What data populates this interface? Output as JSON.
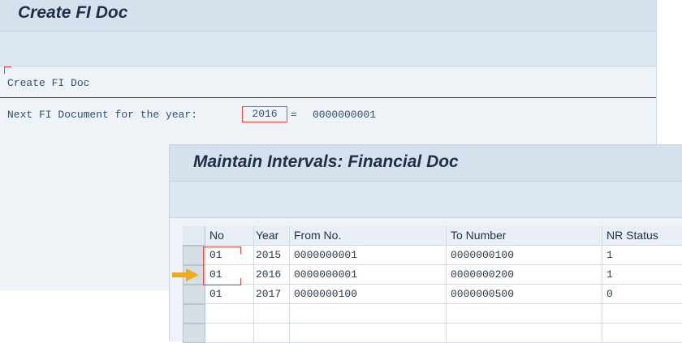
{
  "back_window": {
    "title": "Create FI Doc",
    "heading": "Create FI Doc",
    "label": "Next FI Document for the year:",
    "year_value": "2016",
    "equals": "=",
    "doc_number": "0000000001"
  },
  "front_window": {
    "title": "Maintain Intervals: Financial Doc",
    "table": {
      "headers": [
        "No",
        "Year",
        "From No.",
        "To Number",
        "NR Status"
      ],
      "rows": [
        [
          "01",
          "2015",
          "0000000001",
          "0000000100",
          "1"
        ],
        [
          "01",
          "2016",
          "0000000001",
          "0000000200",
          "1"
        ],
        [
          "01",
          "2017",
          "0000000100",
          "0000000500",
          "0"
        ],
        [
          "",
          "",
          "",
          "",
          ""
        ],
        [
          "",
          "",
          "",
          "",
          ""
        ]
      ]
    }
  },
  "colors": {
    "title_bar": "#d5e2ee",
    "highlight_red": "#e84b3c",
    "arrow_orange": "#f0a81c"
  },
  "icons": {
    "pointer": "arrow-right-icon"
  }
}
